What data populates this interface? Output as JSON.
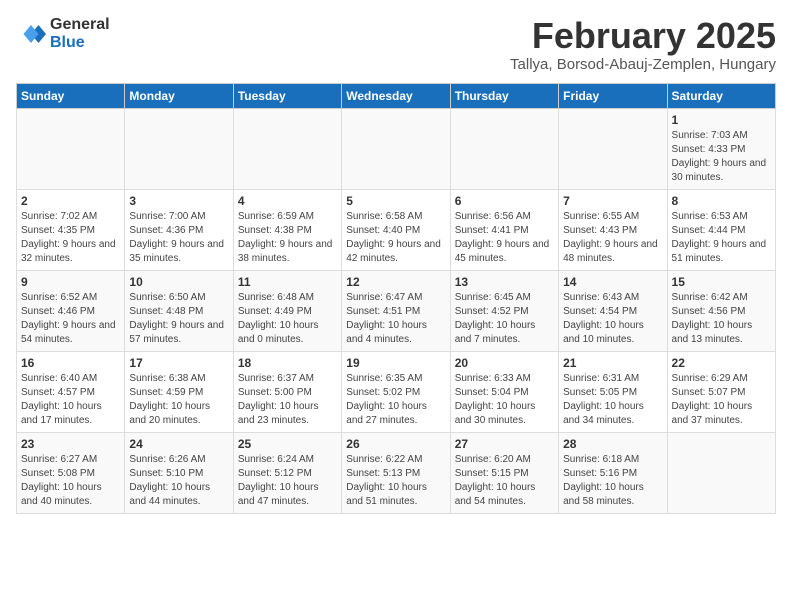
{
  "logo": {
    "general": "General",
    "blue": "Blue"
  },
  "title": "February 2025",
  "location": "Tallya, Borsod-Abauj-Zemplen, Hungary",
  "days_of_week": [
    "Sunday",
    "Monday",
    "Tuesday",
    "Wednesday",
    "Thursday",
    "Friday",
    "Saturday"
  ],
  "weeks": [
    [
      {
        "day": "",
        "info": ""
      },
      {
        "day": "",
        "info": ""
      },
      {
        "day": "",
        "info": ""
      },
      {
        "day": "",
        "info": ""
      },
      {
        "day": "",
        "info": ""
      },
      {
        "day": "",
        "info": ""
      },
      {
        "day": "1",
        "info": "Sunrise: 7:03 AM\nSunset: 4:33 PM\nDaylight: 9 hours and 30 minutes."
      }
    ],
    [
      {
        "day": "2",
        "info": "Sunrise: 7:02 AM\nSunset: 4:35 PM\nDaylight: 9 hours and 32 minutes."
      },
      {
        "day": "3",
        "info": "Sunrise: 7:00 AM\nSunset: 4:36 PM\nDaylight: 9 hours and 35 minutes."
      },
      {
        "day": "4",
        "info": "Sunrise: 6:59 AM\nSunset: 4:38 PM\nDaylight: 9 hours and 38 minutes."
      },
      {
        "day": "5",
        "info": "Sunrise: 6:58 AM\nSunset: 4:40 PM\nDaylight: 9 hours and 42 minutes."
      },
      {
        "day": "6",
        "info": "Sunrise: 6:56 AM\nSunset: 4:41 PM\nDaylight: 9 hours and 45 minutes."
      },
      {
        "day": "7",
        "info": "Sunrise: 6:55 AM\nSunset: 4:43 PM\nDaylight: 9 hours and 48 minutes."
      },
      {
        "day": "8",
        "info": "Sunrise: 6:53 AM\nSunset: 4:44 PM\nDaylight: 9 hours and 51 minutes."
      }
    ],
    [
      {
        "day": "9",
        "info": "Sunrise: 6:52 AM\nSunset: 4:46 PM\nDaylight: 9 hours and 54 minutes."
      },
      {
        "day": "10",
        "info": "Sunrise: 6:50 AM\nSunset: 4:48 PM\nDaylight: 9 hours and 57 minutes."
      },
      {
        "day": "11",
        "info": "Sunrise: 6:48 AM\nSunset: 4:49 PM\nDaylight: 10 hours and 0 minutes."
      },
      {
        "day": "12",
        "info": "Sunrise: 6:47 AM\nSunset: 4:51 PM\nDaylight: 10 hours and 4 minutes."
      },
      {
        "day": "13",
        "info": "Sunrise: 6:45 AM\nSunset: 4:52 PM\nDaylight: 10 hours and 7 minutes."
      },
      {
        "day": "14",
        "info": "Sunrise: 6:43 AM\nSunset: 4:54 PM\nDaylight: 10 hours and 10 minutes."
      },
      {
        "day": "15",
        "info": "Sunrise: 6:42 AM\nSunset: 4:56 PM\nDaylight: 10 hours and 13 minutes."
      }
    ],
    [
      {
        "day": "16",
        "info": "Sunrise: 6:40 AM\nSunset: 4:57 PM\nDaylight: 10 hours and 17 minutes."
      },
      {
        "day": "17",
        "info": "Sunrise: 6:38 AM\nSunset: 4:59 PM\nDaylight: 10 hours and 20 minutes."
      },
      {
        "day": "18",
        "info": "Sunrise: 6:37 AM\nSunset: 5:00 PM\nDaylight: 10 hours and 23 minutes."
      },
      {
        "day": "19",
        "info": "Sunrise: 6:35 AM\nSunset: 5:02 PM\nDaylight: 10 hours and 27 minutes."
      },
      {
        "day": "20",
        "info": "Sunrise: 6:33 AM\nSunset: 5:04 PM\nDaylight: 10 hours and 30 minutes."
      },
      {
        "day": "21",
        "info": "Sunrise: 6:31 AM\nSunset: 5:05 PM\nDaylight: 10 hours and 34 minutes."
      },
      {
        "day": "22",
        "info": "Sunrise: 6:29 AM\nSunset: 5:07 PM\nDaylight: 10 hours and 37 minutes."
      }
    ],
    [
      {
        "day": "23",
        "info": "Sunrise: 6:27 AM\nSunset: 5:08 PM\nDaylight: 10 hours and 40 minutes."
      },
      {
        "day": "24",
        "info": "Sunrise: 6:26 AM\nSunset: 5:10 PM\nDaylight: 10 hours and 44 minutes."
      },
      {
        "day": "25",
        "info": "Sunrise: 6:24 AM\nSunset: 5:12 PM\nDaylight: 10 hours and 47 minutes."
      },
      {
        "day": "26",
        "info": "Sunrise: 6:22 AM\nSunset: 5:13 PM\nDaylight: 10 hours and 51 minutes."
      },
      {
        "day": "27",
        "info": "Sunrise: 6:20 AM\nSunset: 5:15 PM\nDaylight: 10 hours and 54 minutes."
      },
      {
        "day": "28",
        "info": "Sunrise: 6:18 AM\nSunset: 5:16 PM\nDaylight: 10 hours and 58 minutes."
      },
      {
        "day": "",
        "info": ""
      }
    ]
  ]
}
